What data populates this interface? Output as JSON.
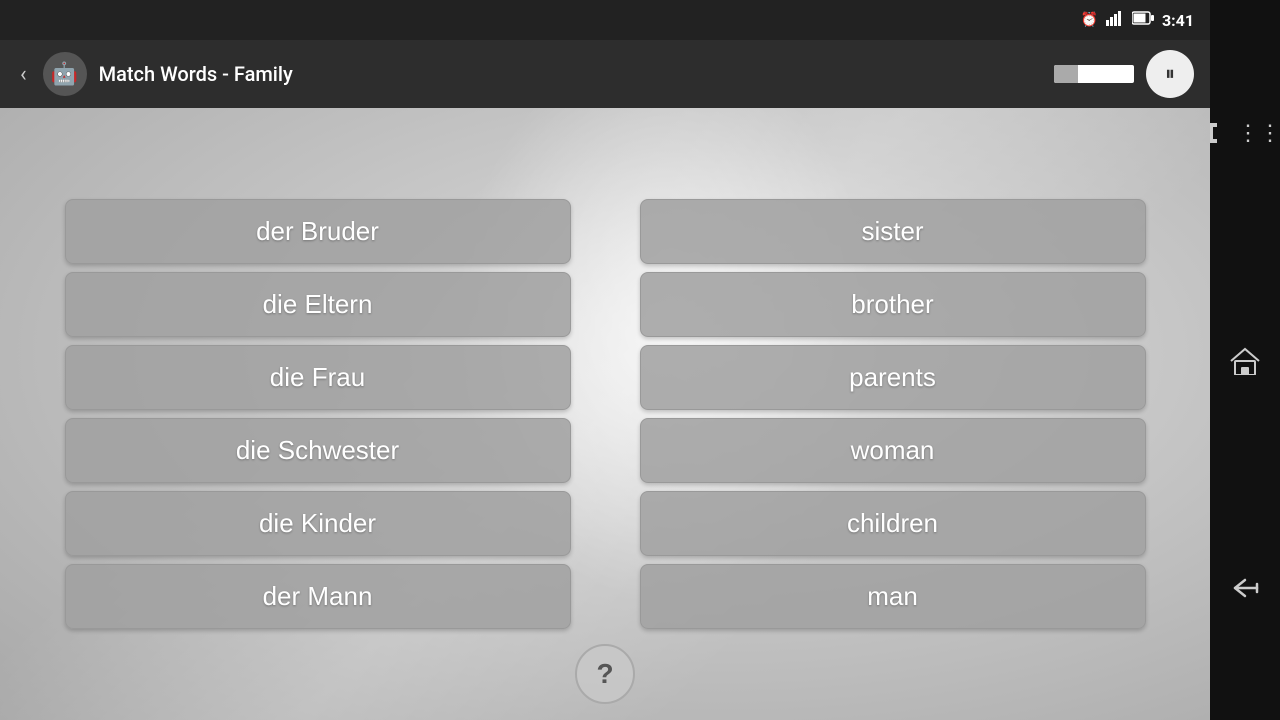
{
  "statusBar": {
    "time": "3:41",
    "icons": [
      "alarm",
      "signal",
      "battery"
    ]
  },
  "header": {
    "backLabel": "‹",
    "title": "Match Words - Family",
    "progressPercent": 30,
    "pauseIcon": "⏸"
  },
  "leftColumn": {
    "words": [
      "der Bruder",
      "die Eltern",
      "die Frau",
      "die Schwester",
      "die Kinder",
      "der Mann"
    ]
  },
  "rightColumn": {
    "words": [
      "sister",
      "brother",
      "parents",
      "woman",
      "children",
      "man"
    ]
  },
  "helpButton": {
    "label": "?"
  },
  "navBar": {
    "items": [
      {
        "name": "menu-icon",
        "symbol": "≡"
      },
      {
        "name": "home-icon",
        "symbol": "⌂"
      },
      {
        "name": "back-icon",
        "symbol": "←"
      }
    ]
  }
}
